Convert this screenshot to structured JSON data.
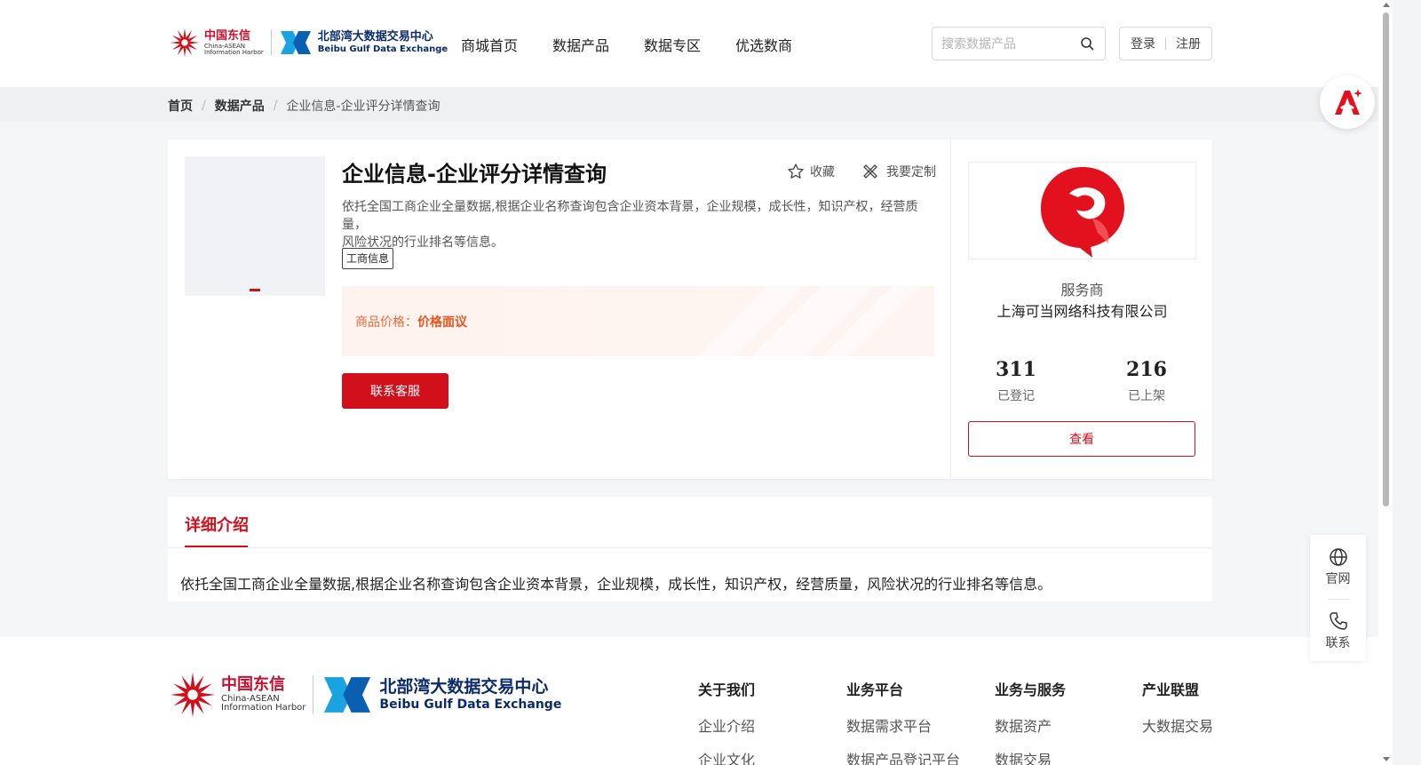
{
  "header": {
    "logo_cn": "中国东信",
    "logo_cn_en1": "China-ASEAN",
    "logo_cn_en2": "Information Harbor",
    "logo_bg_cn": "北部湾大数据交易中心",
    "logo_bg_en": "Beibu Gulf Data Exchange",
    "nav": [
      "商城首页",
      "数据产品",
      "数据专区",
      "优选数商"
    ],
    "search_placeholder": "搜索数据产品",
    "login": "登录",
    "register": "注册"
  },
  "breadcrumb": [
    "首页",
    "数据产品",
    "企业信息-企业评分详情查询"
  ],
  "product": {
    "title": "企业信息-企业评分详情查询",
    "favorite": "收藏",
    "customize": "我要定制",
    "description_line1": "依托全国工商企业全量数据,根据企业名称查询包含企业资本背景，企业规模，成长性，知识产权，经营质量，",
    "description_line2": "风险状况的行业排名等信息。",
    "tag": "工商信息",
    "price_label": "商品价格：",
    "price_value": "价格面议",
    "contact_button": "联系客服"
  },
  "provider": {
    "caption": "服务商",
    "name": "上海可当网络科技有限公司",
    "registered_count": "311",
    "registered_label": "已登记",
    "listed_count": "216",
    "listed_label": "已上架",
    "view_button": "查看"
  },
  "detail": {
    "tab": "详细介绍",
    "text": "依托全国工商企业全量数据,根据企业名称查询包含企业资本背景，企业规模，成长性，知识产权，经营质量，风险状况的行业排名等信息。"
  },
  "footer": {
    "columns": [
      {
        "heading": "关于我们",
        "item1": "企业介绍",
        "item2": "企业文化"
      },
      {
        "heading": "业务平台",
        "item1": "数据需求平台",
        "item2": "数据产品登记平台"
      },
      {
        "heading": "业务与服务",
        "item1": "数据资产",
        "item2": "数据交易"
      },
      {
        "heading": "产业联盟",
        "item1": "大数据交易",
        "item2": ""
      }
    ]
  },
  "side": {
    "website": "官网",
    "contact": "联系"
  },
  "colors": {
    "accent": "#d2101c",
    "price": "#e8561f"
  }
}
